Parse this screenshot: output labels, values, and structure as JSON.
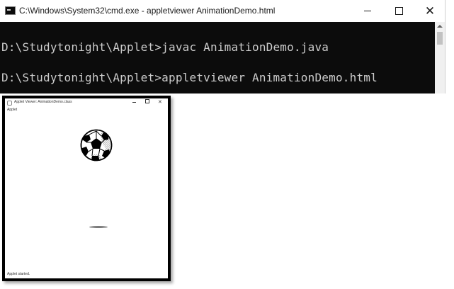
{
  "cmd": {
    "title": "C:\\Windows\\System32\\cmd.exe - appletviewer  AnimationDemo.html",
    "icon": "cmd-icon",
    "lines": [
      "D:\\Studytonight\\Applet>javac AnimationDemo.java",
      "D:\\Studytonight\\Applet>appletviewer AnimationDemo.html"
    ],
    "colors": {
      "background": "#0c0c0c",
      "text": "#cccccc"
    }
  },
  "applet": {
    "title": "Applet Viewer: AnimationDemo.class",
    "menu": "Applet",
    "status": "Applet started.",
    "ball_icon": "soccer-ball",
    "shadow_icon": "ball-shadow"
  }
}
